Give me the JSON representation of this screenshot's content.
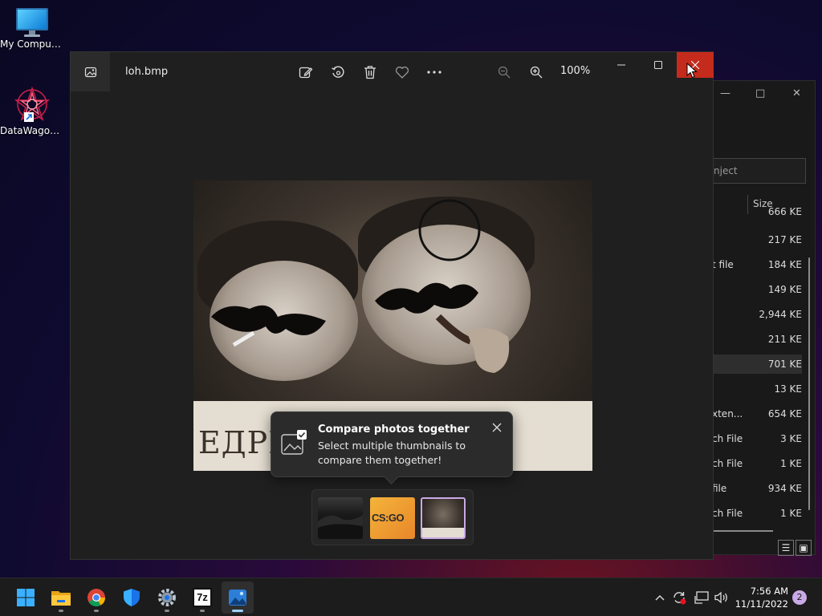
{
  "desktop": {
    "icons": [
      {
        "label": "My Computer"
      },
      {
        "label": "DataWagon..."
      }
    ]
  },
  "explorer": {
    "search_placeholder": "nject",
    "size_header": "Size",
    "rows": [
      {
        "type": "",
        "size": "666 KE"
      },
      {
        "type": "",
        "size": "217 KE"
      },
      {
        "type": "t file",
        "size": "184 KE"
      },
      {
        "type": "",
        "size": "149 KE"
      },
      {
        "type": "",
        "size": "2,944 KE"
      },
      {
        "type": "",
        "size": "211 KE"
      },
      {
        "type": "",
        "size": "701 KE"
      },
      {
        "type": "",
        "size": "13 KE"
      },
      {
        "type": "xten...",
        "size": "654 KE"
      },
      {
        "type": "ch File",
        "size": "3 KE"
      },
      {
        "type": "ch File",
        "size": "1 KE"
      },
      {
        "type": "file",
        "size": "934 KE"
      },
      {
        "type": "ch File",
        "size": "1 KE"
      }
    ]
  },
  "photos": {
    "filename": "loh.bmp",
    "zoom": "100%",
    "banner_text": "ЕДРИ               ЮЧЪ",
    "tip": {
      "title": "Compare photos together",
      "body": "Select multiple thumbnails to compare them together!"
    },
    "thumb2_label": "CS:GO",
    "accent": "#c9a9e6",
    "close_color": "#c42b1c"
  },
  "taskbar": {
    "time": "7:56 AM",
    "date": "11/11/2022",
    "notifications": "2",
    "sevenzip_label": "7z"
  }
}
